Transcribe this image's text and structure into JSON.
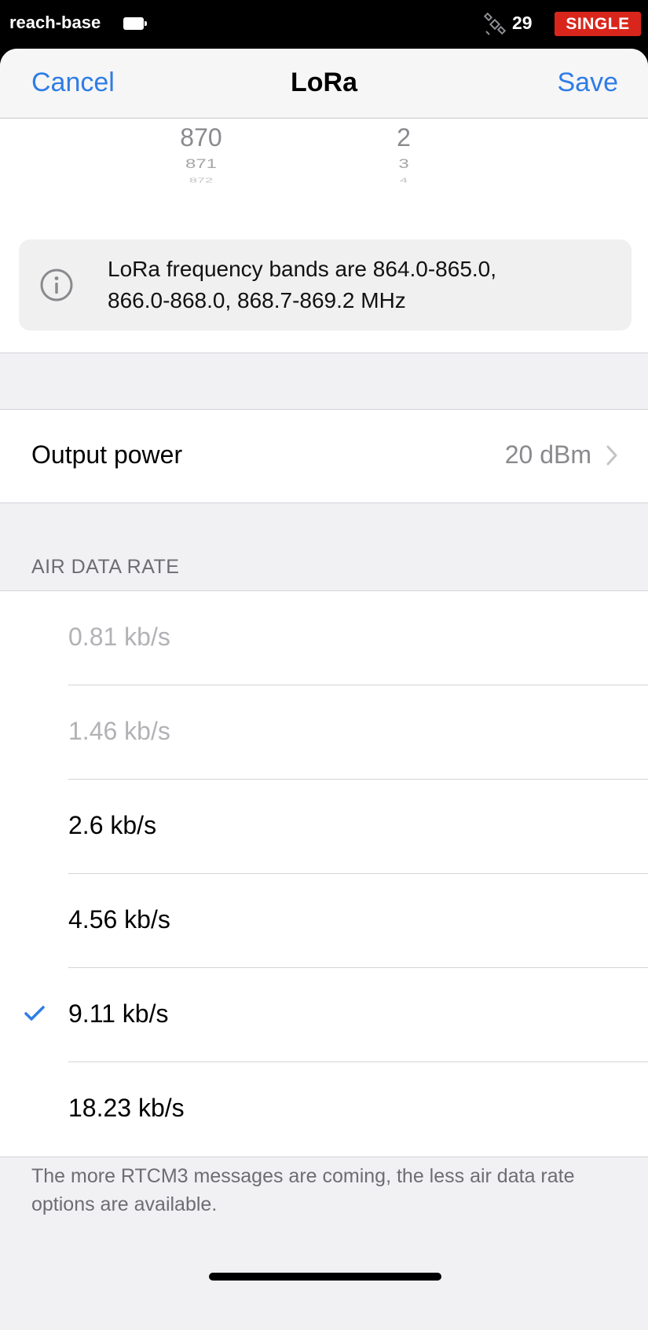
{
  "status_bar": {
    "device_name": "reach-base",
    "satellite_count": "29",
    "mode": "SINGLE",
    "mode_color": "#d9261c"
  },
  "nav": {
    "cancel_label": "Cancel",
    "title": "LoRa",
    "save_label": "Save",
    "accent_color": "#2f7ce6"
  },
  "frequency_picker": {
    "column_1": [
      "870",
      "871",
      "872"
    ],
    "column_2": [
      "2",
      "3",
      "4"
    ]
  },
  "info": {
    "icon": "info-circle-icon",
    "text_line_1": "LoRa frequency bands are 864.0-865.0,",
    "text_line_2": "866.0-868.0, 868.7-869.2 MHz"
  },
  "output_power": {
    "label": "Output power",
    "value": "20 dBm"
  },
  "air_data_rate": {
    "header": "AIR DATA RATE",
    "options": [
      {
        "label": "0.81 kb/s",
        "enabled": false,
        "selected": false
      },
      {
        "label": "1.46 kb/s",
        "enabled": false,
        "selected": false
      },
      {
        "label": "2.6 kb/s",
        "enabled": true,
        "selected": false
      },
      {
        "label": "4.56 kb/s",
        "enabled": true,
        "selected": false
      },
      {
        "label": "9.11 kb/s",
        "enabled": true,
        "selected": true
      },
      {
        "label": "18.23 kb/s",
        "enabled": true,
        "selected": false
      }
    ],
    "footer_line_1": "The more RTCM3 messages are coming, the less air data rate",
    "footer_line_2": "options are available."
  }
}
